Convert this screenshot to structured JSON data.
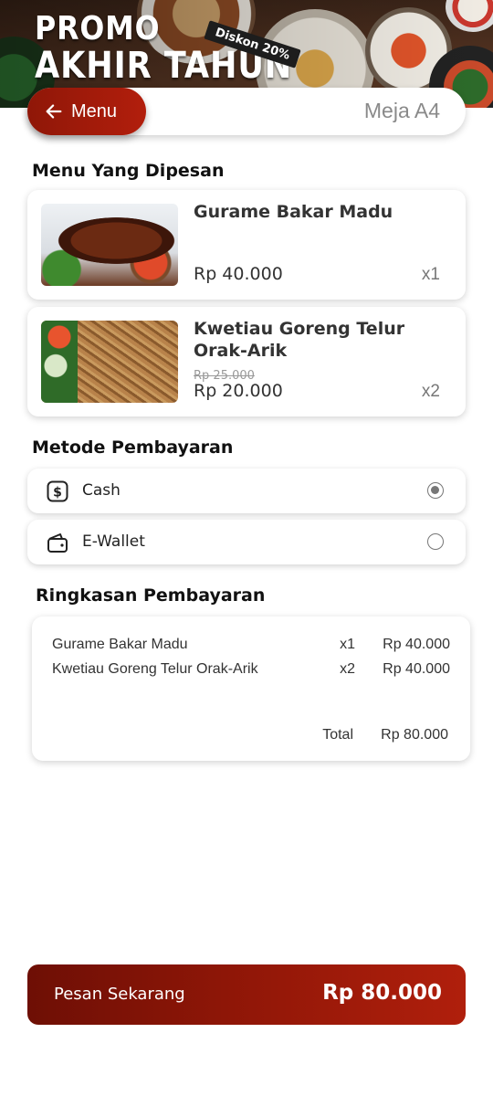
{
  "banner": {
    "title_line1": "PROMO",
    "title_line2": "AKHIR TAHUN",
    "discount": "Diskon 20%"
  },
  "header": {
    "menu_label": "Menu",
    "table": "Meja A4"
  },
  "ordered_section": {
    "title": "Menu Yang Dipesan",
    "items": [
      {
        "name": "Gurame Bakar Madu",
        "price": "Rp 40.000",
        "old_price": "",
        "qty": "x1",
        "image": "grilled-gourami-photo"
      },
      {
        "name": "Kwetiau Goreng Telur Orak-Arik",
        "price": "Rp 20.000",
        "old_price": "Rp 25.000",
        "qty": "x2",
        "image": "fried-kwetiau-photo"
      }
    ]
  },
  "payment_section": {
    "title": "Metode Pembayaran",
    "options": [
      {
        "label": "Cash",
        "icon": "cash-icon",
        "selected": true
      },
      {
        "label": "E-Wallet",
        "icon": "wallet-icon",
        "selected": false
      }
    ]
  },
  "summary_section": {
    "title": "Ringkasan Pembayaran",
    "rows": [
      {
        "name": "Gurame Bakar Madu",
        "qty": "x1",
        "price": "Rp 40.000"
      },
      {
        "name": "Kwetiau Goreng Telur Orak-Arik",
        "qty": "x2",
        "price": "Rp 40.000"
      }
    ],
    "total_label": "Total",
    "total_value": "Rp 80.000"
  },
  "order_button": {
    "label": "Pesan Sekarang",
    "total": "Rp 80.000"
  },
  "colors": {
    "primary": "#9e1a0a",
    "primary_dark": "#6e0f05"
  }
}
